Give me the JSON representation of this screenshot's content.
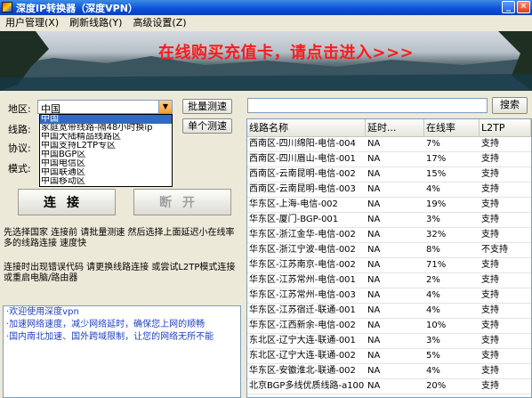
{
  "window": {
    "title": "深度IP转换器（深度VPN）"
  },
  "menu": [
    "用户管理(X)",
    "刷新线路(Y)",
    "高级设置(Z)"
  ],
  "banner": {
    "text": "在线购买充值卡，请点击进入>>>"
  },
  "form": {
    "region_label": "地区:",
    "region_value": "中国",
    "line_label": "线路:",
    "protocol_label": "协议:",
    "mode_label": "模式:",
    "batch_test_label": "批量测速",
    "single_test_label": "单个测速"
  },
  "dropdown": [
    "中国",
    "家庭宽带线路-隔48小时换ip",
    "中国大陆精品线路区",
    "中国支持L2TP专区",
    "中国BGP区",
    "中国电信区",
    "中国联通区",
    "中国移动区"
  ],
  "buttons": {
    "connect": "连接",
    "disconnect": "断开",
    "search": "搜索"
  },
  "hints": {
    "tip1": "先选择国家 连接前 请批量测速 然后选择上面延迟小在线率多的线路连接 速度快",
    "tip2": "连接时出现错误代码 请更换线路连接 或尝试L2TP模式连接或重启电脑/路由器"
  },
  "news": [
    "·欢迎使用深度vpn",
    "·加速网络速度，减少网络延时，确保您上网的顺畅",
    "·国内南北加速、国外跨域限制，让您的网络无所不能"
  ],
  "table": {
    "headers": [
      "线路名称",
      "延时...",
      "在线率",
      "L2TP"
    ],
    "rows": [
      [
        "西南区-四川绵阳-电信-004",
        "NA",
        "7%",
        "支持"
      ],
      [
        "西南区-四川眉山-电信-001",
        "NA",
        "17%",
        "支持"
      ],
      [
        "西南区-云南昆明-电信-002",
        "NA",
        "15%",
        "支持"
      ],
      [
        "西南区-云南昆明-电信-003",
        "NA",
        "4%",
        "支持"
      ],
      [
        "华东区-上海-电信-002",
        "NA",
        "19%",
        "支持"
      ],
      [
        "华东区-厦门-BGP-001",
        "NA",
        "3%",
        "支持"
      ],
      [
        "华东区-浙江金华-电信-002",
        "NA",
        "32%",
        "支持"
      ],
      [
        "华东区-浙江宁波-电信-002",
        "NA",
        "8%",
        "不支持"
      ],
      [
        "华东区-江苏南京-电信-002",
        "NA",
        "71%",
        "支持"
      ],
      [
        "华东区-江苏常州-电信-001",
        "NA",
        "2%",
        "支持"
      ],
      [
        "华东区-江苏常州-电信-003",
        "NA",
        "4%",
        "支持"
      ],
      [
        "华东区-江苏宿迁-联通-001",
        "NA",
        "4%",
        "支持"
      ],
      [
        "华东区-江西新余-电信-002",
        "NA",
        "10%",
        "支持"
      ],
      [
        "东北区-辽宁大连-联通-001",
        "NA",
        "3%",
        "支持"
      ],
      [
        "东北区-辽宁大连-联通-002",
        "NA",
        "5%",
        "支持"
      ],
      [
        "华东区-安徽淮北-联通-002",
        "NA",
        "4%",
        "支持"
      ],
      [
        "北京BGP多线优质线路-a100",
        "NA",
        "20%",
        "支持"
      ]
    ]
  },
  "colors": {
    "titlebar": "#0a4fd6",
    "banner_text": "#ff1a1a",
    "selection": "#316ac5",
    "news_text": "#1f3fbf"
  }
}
